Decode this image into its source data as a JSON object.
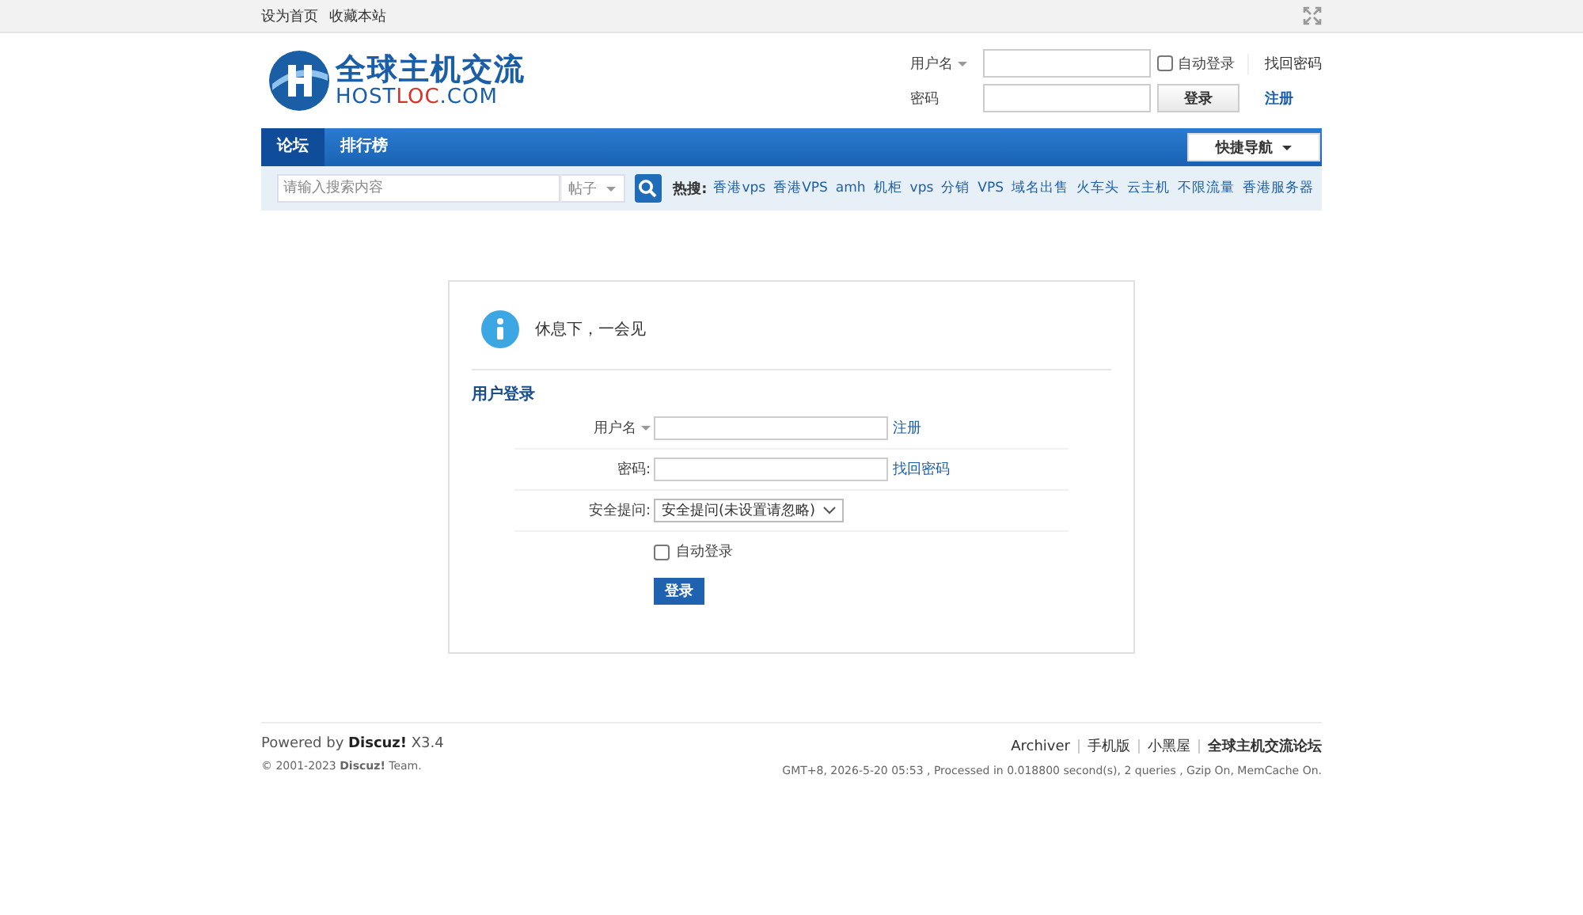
{
  "topbar": {
    "links": [
      "设为首页",
      "收藏本站"
    ]
  },
  "header": {
    "logo": {
      "title": "全球主机交流",
      "subtitle_a": "HOST",
      "subtitle_b": "LOC",
      "subtitle_c": ".COM"
    },
    "login": {
      "username_label": "用户名",
      "autologin": {
        "label": "自动登录",
        "checked": false
      },
      "forgot": "找回密码",
      "password_label": "密码",
      "button": "登录",
      "register": "注册"
    }
  },
  "nav": {
    "items": [
      {
        "label": "论坛",
        "selected": true
      },
      {
        "label": "排行榜",
        "selected": false
      }
    ],
    "quick_nav": "快捷导航"
  },
  "search": {
    "placeholder": "请输入搜索内容",
    "type": "帖子",
    "hot_label": "热搜:",
    "hot": [
      "香港vps",
      "香港VPS",
      "amh",
      "机柜",
      "vps",
      "分销",
      "VPS",
      "域名出售",
      "火车头",
      "云主机",
      "不限流量",
      "香港服务器"
    ]
  },
  "message": "休息下，一会见",
  "login_form": {
    "title": "用户登录",
    "username_label": "用户名",
    "register": "注册",
    "password_label": "密码:",
    "forgot": "找回密码",
    "question_label": "安全提问:",
    "question_value": "安全提问(未设置请忽略)",
    "autologin": {
      "label": "自动登录",
      "checked": false
    },
    "button": "登录"
  },
  "footer": {
    "powered": "Powered by **Discuz!** X3.4",
    "copyright": "© 2001-2023 **Discuz!** Team.",
    "links": [
      {
        "label": "Archiver",
        "bold": false
      },
      {
        "label": "手机版",
        "bold": false
      },
      {
        "label": "小黑屋",
        "bold": false
      },
      {
        "label": "全球主机交流论坛",
        "bold": true
      }
    ],
    "stats": "GMT+8, 2026-5-20 05:53 , Processed in 0.018800 second(s), 2 queries , Gzip On, MemCache On."
  }
}
